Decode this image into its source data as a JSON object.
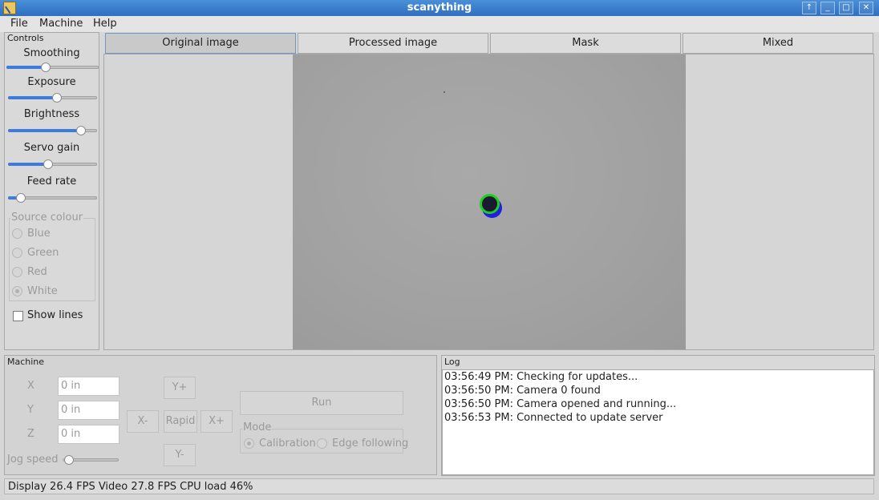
{
  "window": {
    "title": "scanything"
  },
  "menu": [
    "File",
    "Machine",
    "Help"
  ],
  "controls": {
    "title": "Controls",
    "sliders": [
      {
        "label": "Smoothing",
        "value": 0.43
      },
      {
        "label": "Exposure",
        "value": 0.55
      },
      {
        "label": "Brightness",
        "value": 0.82
      },
      {
        "label": "Servo gain",
        "value": 0.45
      },
      {
        "label": "Feed rate",
        "value": 0.14
      }
    ],
    "source_colour": {
      "title": "Source colour",
      "options": [
        "Blue",
        "Green",
        "Red",
        "White"
      ],
      "selected": "White"
    },
    "show_lines_label": "Show lines"
  },
  "tabs": [
    "Original image",
    "Processed image",
    "Mask",
    "Mixed"
  ],
  "active_tab": "Original image",
  "machine": {
    "title": "Machine",
    "x_label": "X",
    "y_label": "Y",
    "z_label": "Z",
    "x_value": "0 in",
    "y_value": "0 in",
    "z_value": "0 in",
    "jog_speed_label": "Jog speed",
    "jog_speed_value": 0.12,
    "buttons": {
      "y_plus": "Y+",
      "y_minus": "Y-",
      "x_minus": "X-",
      "x_plus": "X+",
      "rapid": "Rapid",
      "run": "Run"
    },
    "mode": {
      "title": "Mode",
      "calibration": "Calibration",
      "edge_following": "Edge following",
      "selected": "Calibration"
    }
  },
  "log": {
    "title": "Log",
    "lines": [
      "03:56:49 PM: Checking for updates...",
      "03:56:50 PM: Camera 0 found",
      "03:56:50 PM: Camera opened and running...",
      "03:56:53 PM: Connected to update server"
    ]
  },
  "status": "Display 26.4 FPS Video 27.8 FPS CPU load 46%",
  "colors": {
    "accent": "#3b7dd8",
    "titlebar": "#3a7fcf",
    "marker_green": "#1ecf1e",
    "marker_blue": "#2020e0"
  }
}
